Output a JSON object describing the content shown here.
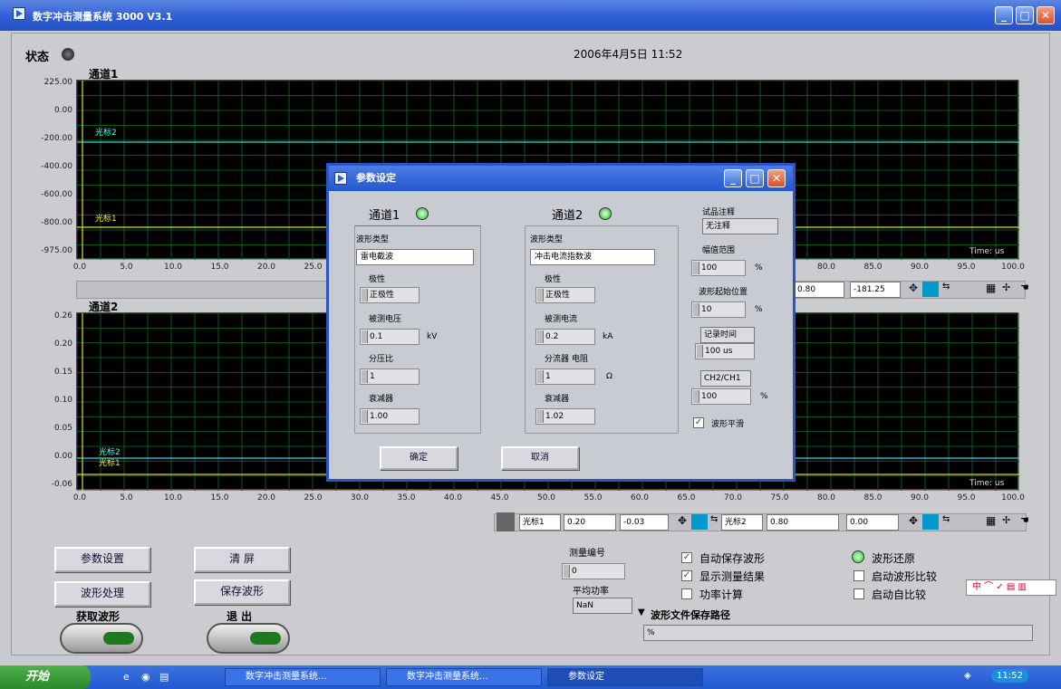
{
  "window": {
    "title": "数字冲击测量系统 3000 V3.1"
  },
  "status": {
    "label": "状态",
    "datetime": "2006年4月5日   11:52"
  },
  "graph1": {
    "title": "通道1",
    "yticks": [
      "225.00",
      "0.00",
      "-200.00",
      "-400.00",
      "-600.00",
      "-800.00",
      "-975.00"
    ],
    "cursor1": "光标1",
    "cursor2": "光标2",
    "time_unit": "Time: us",
    "xticks": [
      "0.0",
      "5.0",
      "10.0",
      "15.0",
      "20.0",
      "25.0",
      "80.0",
      "85.0",
      "90.0",
      "95.0",
      "100.0"
    ],
    "right_fields": [
      "0.80",
      "-181.25"
    ]
  },
  "graph2": {
    "title": "通道2",
    "yticks": [
      "0.26",
      "0.20",
      "0.15",
      "0.10",
      "0.05",
      "0.00",
      "-0.06"
    ],
    "cursor1": "光标1",
    "cursor2": "光标2",
    "time_unit": "Time: us",
    "xticks": [
      "0.0",
      "5.0",
      "10.0",
      "15.0",
      "20.0",
      "25.0",
      "30.0",
      "35.0",
      "40.0",
      "45.0",
      "50.0",
      "55.0",
      "60.0",
      "65.0",
      "70.0",
      "75.0",
      "80.0",
      "85.0",
      "90.0",
      "95.0",
      "100.0"
    ],
    "cursor_fields": {
      "c1_label": "光标1",
      "c1_x": "0.20",
      "c1_y": "-0.03",
      "c2_label": "光标2",
      "c2_x": "0.80",
      "c2_y": "0.00"
    }
  },
  "buttons": {
    "params": "参数设置",
    "clear": "清 屏",
    "process": "波形处理",
    "save": "保存波形",
    "acquire": "获取波形",
    "exit": "退 出"
  },
  "measure": {
    "id_label": "测量编号",
    "id_value": "0",
    "power_label": "平均功率",
    "power_value": "NaN",
    "path_label": "波形文件保存路径",
    "path_value": "%"
  },
  "options": {
    "auto_save": "自动保存波形",
    "show_result": "显示测量结果",
    "power_calc": "功率计算",
    "restore": "波形还原",
    "compare": "启动波形比较",
    "self_compare": "启动自比较"
  },
  "ime": "中 ⌒ ✓ ▤ ▥",
  "dialog": {
    "title": "参数设定",
    "ch1": {
      "title": "通道1",
      "wave_type_label": "波形类型",
      "wave_type": "雷电截波",
      "polarity_label": "极性",
      "polarity": "正极性",
      "measured_label": "被测电压",
      "measured_value": "0.1",
      "measured_unit": "kV",
      "ratio_label": "分压比",
      "ratio_value": "1",
      "atten_label": "衰减器",
      "atten_value": "1.00"
    },
    "ch2": {
      "title": "通道2",
      "wave_type_label": "波形类型",
      "wave_type": "冲击电流指数波",
      "polarity_label": "极性",
      "polarity": "正极性",
      "measured_label": "被测电流",
      "measured_value": "0.2",
      "measured_unit": "kA",
      "shunt_label": "分流器 电阻",
      "shunt_value": "1",
      "shunt_unit": "Ω",
      "atten_label": "衰减器",
      "atten_value": "1.02"
    },
    "right": {
      "note_label": "试品注释",
      "note_value": "无注释",
      "range_label": "幅值范围",
      "range_value": "100",
      "range_unit": "%",
      "start_label": "波形起始位置",
      "start_value": "10",
      "start_unit": "%",
      "time_label": "记录时间",
      "time_value": "100 us",
      "ratio_label": "CH2/CH1",
      "ratio_value": "100",
      "ratio_unit": "%",
      "smooth_label": "波形平滑"
    },
    "ok": "确定",
    "cancel": "取消"
  },
  "taskbar": {
    "start": "开始",
    "tasks": [
      "数字冲击测量系统...",
      "数字冲击测量系统...",
      "参数设定"
    ],
    "clock": "11:52"
  }
}
